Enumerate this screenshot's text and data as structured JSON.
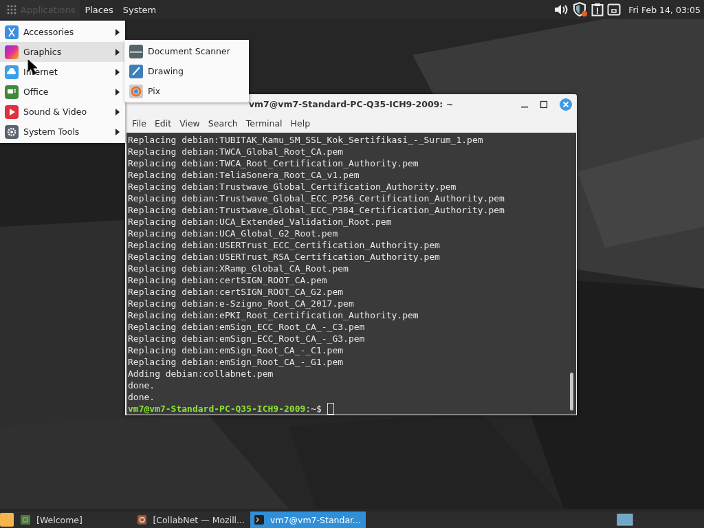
{
  "top_panel": {
    "menus": [
      {
        "label": "Applications",
        "selected": true
      },
      {
        "label": "Places",
        "selected": false
      },
      {
        "label": "System",
        "selected": false
      }
    ],
    "clock": "Fri Feb 14, 03:05"
  },
  "applications_menu": [
    {
      "label": "Accessories",
      "kind": "accessories",
      "selected": false
    },
    {
      "label": "Graphics",
      "kind": "graphics",
      "selected": true
    },
    {
      "label": "Internet",
      "kind": "internet",
      "selected": false
    },
    {
      "label": "Office",
      "kind": "office",
      "selected": false
    },
    {
      "label": "Sound & Video",
      "kind": "media",
      "selected": false
    },
    {
      "label": "System Tools",
      "kind": "tools",
      "selected": false
    }
  ],
  "graphics_submenu": [
    {
      "label": "Document Scanner",
      "kind": "scanner"
    },
    {
      "label": "Drawing",
      "kind": "drawing"
    },
    {
      "label": "Pix",
      "kind": "pix"
    }
  ],
  "terminal": {
    "title": "vm7@vm7-Standard-PC-Q35-ICH9-2009: ~",
    "menu": [
      "File",
      "Edit",
      "View",
      "Search",
      "Terminal",
      "Help"
    ],
    "lines": [
      "Replacing debian:TUBITAK_Kamu_SM_SSL_Kok_Sertifikasi_-_Surum_1.pem",
      "Replacing debian:TWCA_Global_Root_CA.pem",
      "Replacing debian:TWCA_Root_Certification_Authority.pem",
      "Replacing debian:TeliaSonera_Root_CA_v1.pem",
      "Replacing debian:Trustwave_Global_Certification_Authority.pem",
      "Replacing debian:Trustwave_Global_ECC_P256_Certification_Authority.pem",
      "Replacing debian:Trustwave_Global_ECC_P384_Certification_Authority.pem",
      "Replacing debian:UCA_Extended_Validation_Root.pem",
      "Replacing debian:UCA_Global_G2_Root.pem",
      "Replacing debian:USERTrust_ECC_Certification_Authority.pem",
      "Replacing debian:USERTrust_RSA_Certification_Authority.pem",
      "Replacing debian:XRamp_Global_CA_Root.pem",
      "Replacing debian:certSIGN_ROOT_CA.pem",
      "Replacing debian:certSIGN_ROOT_CA_G2.pem",
      "Replacing debian:e-Szigno_Root_CA_2017.pem",
      "Replacing debian:ePKI_Root_Certification_Authority.pem",
      "Replacing debian:emSign_ECC_Root_CA_-_C3.pem",
      "Replacing debian:emSign_ECC_Root_CA_-_G3.pem",
      "Replacing debian:emSign_Root_CA_-_C1.pem",
      "Replacing debian:emSign_Root_CA_-_G1.pem",
      "Adding debian:collabnet.pem",
      "done.",
      "done."
    ],
    "prompt_user": "vm7@vm7-Standard-PC-Q35-ICH9-2009",
    "prompt_rest": ":~$"
  },
  "taskbar": [
    {
      "label": "[Welcome]",
      "kind": "app",
      "selected": false
    },
    {
      "label": "[CollabNet — Mozill...",
      "kind": "browser",
      "selected": false
    },
    {
      "label": "vm7@vm7-Standar...",
      "kind": "terminal",
      "selected": true
    }
  ]
}
